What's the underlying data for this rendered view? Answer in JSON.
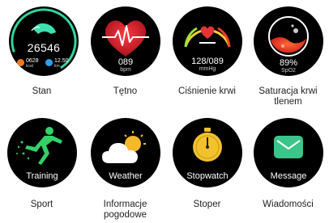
{
  "tiles": [
    {
      "label": "Stan",
      "face": {
        "steps": "26546",
        "calories": "0628",
        "calories_unit": "kcal",
        "distance": "12.50",
        "distance_unit": "km"
      }
    },
    {
      "label": "Tętno",
      "face": {
        "value": "089",
        "unit": "bpm"
      }
    },
    {
      "label": "Ciśnienie krwi",
      "face": {
        "value": "128/089",
        "unit": "mmHg"
      }
    },
    {
      "label": "Saturacja krwi tlenem",
      "face": {
        "value": "89%",
        "unit": "SpO2"
      }
    },
    {
      "label": "Sport",
      "face": {
        "caption": "Training"
      }
    },
    {
      "label": "Informacje pogodowe",
      "face": {
        "caption": "Weather"
      }
    },
    {
      "label": "Stoper",
      "face": {
        "caption": "Stopwatch"
      }
    },
    {
      "label": "Wiadomości",
      "face": {
        "caption": "Message"
      }
    }
  ],
  "colors": {
    "steps_ring": "#2fd6a0",
    "heart": "#e8323a",
    "spo2": "#e84a2a",
    "stopwatch": "#f2c12e",
    "message": "#3cc48a",
    "sun": "#f5b82a"
  }
}
